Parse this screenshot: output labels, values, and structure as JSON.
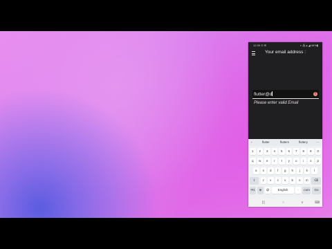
{
  "status_bar": {
    "time": "12:39 ⊙ ✉",
    "right": "◐ ⁂ ▴ ◢ 46%▮"
  },
  "app_bar": {
    "title": "Your email address :",
    "menu_icon": "menu-icon"
  },
  "email_field": {
    "value": "flutter@d",
    "error_icon": "error-circle-icon"
  },
  "error_message": "Please enter valid Email",
  "keyboard": {
    "suggestions": {
      "back_icon": "‹",
      "items": [
        "flutter",
        "flutters",
        "fluttery"
      ],
      "more_icon": "⋯"
    },
    "row_numbers": [
      "1",
      "2",
      "3",
      "4",
      "5",
      "6",
      "7",
      "8",
      "9",
      "0"
    ],
    "row_q": [
      "q",
      "w",
      "e",
      "r",
      "t",
      "y",
      "u",
      "i",
      "o",
      "p"
    ],
    "row_a": [
      "a",
      "s",
      "d",
      "f",
      "g",
      "h",
      "j",
      "k",
      "l"
    ],
    "row_z": [
      "⇧",
      "z",
      "x",
      "c",
      "v",
      "b",
      "n",
      "m",
      "⌫"
    ],
    "row_bottom": [
      "!#1",
      "⊕",
      "@",
      "English",
      "·",
      ".com",
      "Go"
    ]
  },
  "nav_bar": {
    "recents": "|||",
    "home": "○",
    "back": "∨",
    "keyboard": "⌨"
  }
}
